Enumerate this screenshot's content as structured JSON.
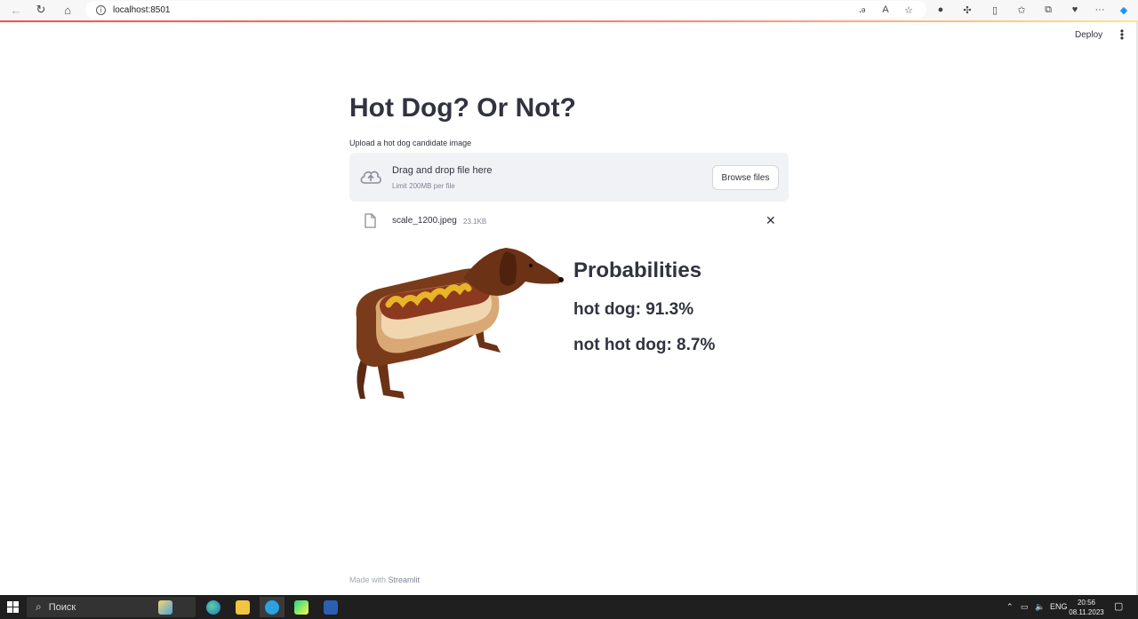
{
  "browser": {
    "url": "localhost:8501"
  },
  "header": {
    "deploy_label": "Deploy",
    "menu_glyph": "⋮"
  },
  "main": {
    "title": "Hot Dog? Or Not?",
    "uploader": {
      "label": "Upload a hot dog candidate image",
      "drop_title": "Drag and drop file here",
      "limit": "Limit 200MB per file",
      "browse_label": "Browse files"
    },
    "file": {
      "name": "scale_1200.jpeg",
      "size": "23.1KB"
    },
    "results": {
      "heading": "Probabilities",
      "hot_dog": "hot dog: 91.3%",
      "not_hot_dog": "not hot dog: 8.7%"
    }
  },
  "footer": {
    "made_with": "Made with",
    "brand": "Streamlit"
  },
  "taskbar": {
    "search_placeholder": "Поиск",
    "language": "ENG",
    "time": "20:56",
    "date": "08.11.2023"
  },
  "colors": {
    "text": "#31333f",
    "dropzone_bg": "#f0f2f6",
    "accent": "#ff4b4b"
  }
}
